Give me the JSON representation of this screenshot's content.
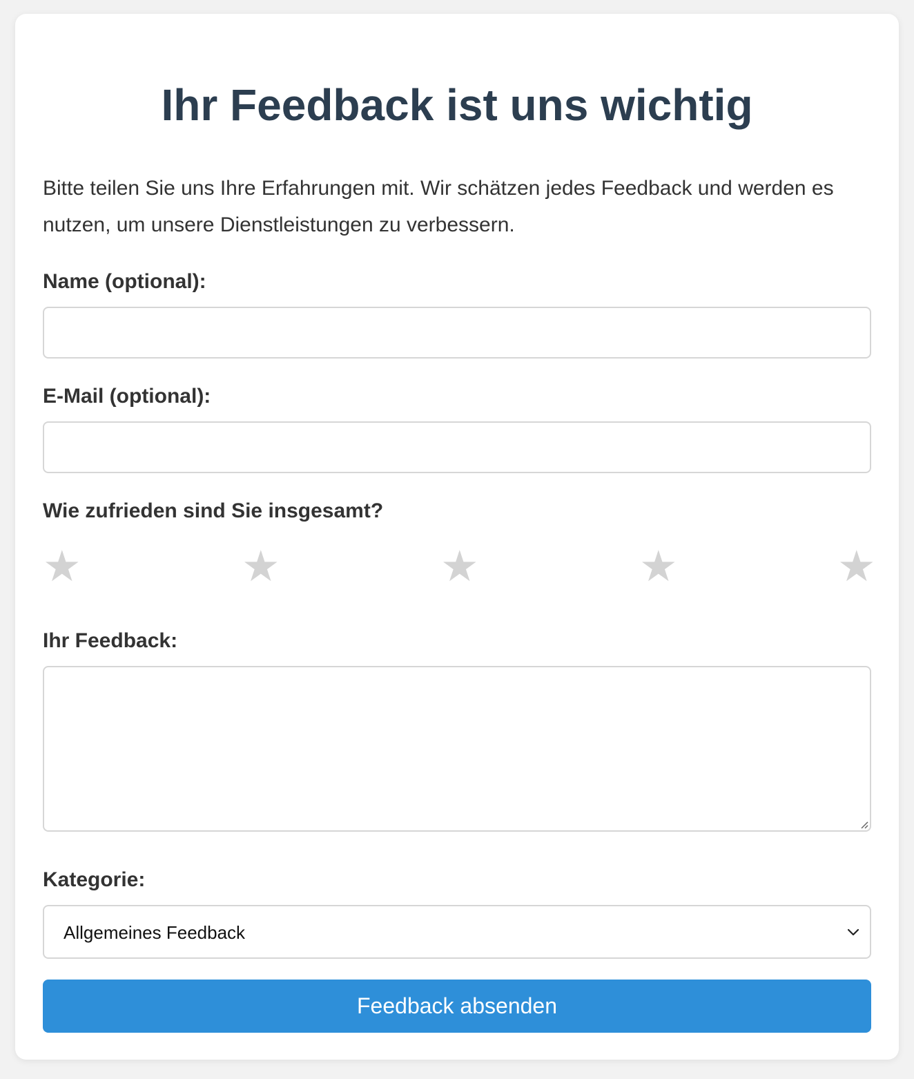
{
  "form": {
    "title": "Ihr Feedback ist uns wichtig",
    "intro": "Bitte teilen Sie uns Ihre Erfahrungen mit. Wir schätzen jedes Feedback und werden es nutzen, um unsere Dienstleistungen zu verbessern.",
    "name_label": "Name (optional):",
    "name_value": "",
    "email_label": "E-Mail (optional):",
    "email_value": "",
    "rating_label": "Wie zufrieden sind Sie insgesamt?",
    "rating": {
      "max": 5,
      "selected": 0,
      "star_glyph": "★",
      "empty_color": "#d3d3d3"
    },
    "feedback_label": "Ihr Feedback:",
    "feedback_value": "",
    "category_label": "Kategorie:",
    "category_selected": "Allgemeines Feedback",
    "submit_label": "Feedback absenden"
  },
  "colors": {
    "background": "#f2f2f2",
    "card": "#ffffff",
    "title": "#2c3e50",
    "text": "#333333",
    "border": "#d6d6d6",
    "button": "#2e8fd9",
    "button_text": "#ffffff"
  },
  "icons": {
    "star": "star-icon",
    "select_arrow": "chevron-down-icon",
    "resize": "resize-grip-icon"
  }
}
